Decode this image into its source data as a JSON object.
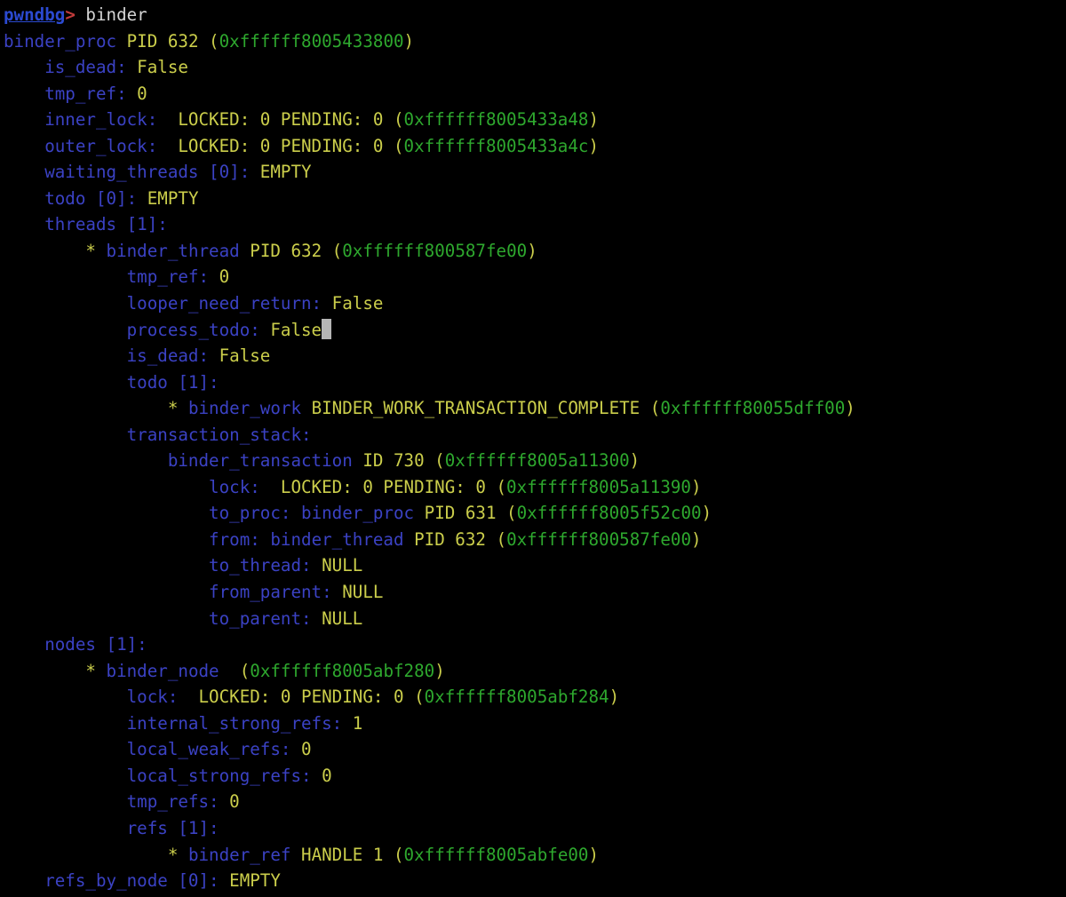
{
  "terminal": {
    "app": "pwndbg",
    "prompt": "pwndbg",
    "prompt_arrow": ">",
    "command": "binder",
    "cursor": "block",
    "colors": {
      "background": "#000000",
      "field": "#3b42c4",
      "value": "#cbce4b",
      "address": "#2ea82e",
      "command_text": "#d4d4d4",
      "prompt": "#2b4ad1",
      "prompt_arrow": "#c23b3b",
      "cursor": "#b5b5b5"
    },
    "lines": [
      {
        "id": "prompt-line",
        "segments": [
          {
            "t": "pwndbg",
            "c": "prompt"
          },
          {
            "t": ">",
            "c": "arrow"
          },
          {
            "t": " binder",
            "c": "white"
          }
        ]
      },
      {
        "id": "binder-proc-header",
        "segments": [
          {
            "t": "binder_proc",
            "c": "blue"
          },
          {
            "t": " PID 632 (",
            "c": "yellow"
          },
          {
            "t": "0xffffff8005433800",
            "c": "green"
          },
          {
            "t": ")",
            "c": "yellow"
          }
        ]
      },
      {
        "id": "proc-is-dead",
        "segments": [
          {
            "t": "    is_dead:",
            "c": "blue"
          },
          {
            "t": " False",
            "c": "yellow"
          }
        ]
      },
      {
        "id": "proc-tmp-ref",
        "segments": [
          {
            "t": "    tmp_ref:",
            "c": "blue"
          },
          {
            "t": " 0",
            "c": "yellow"
          }
        ]
      },
      {
        "id": "proc-inner-lock",
        "segments": [
          {
            "t": "    inner_lock:",
            "c": "blue"
          },
          {
            "t": "  LOCKED: 0 PENDING: 0 (",
            "c": "yellow"
          },
          {
            "t": "0xffffff8005433a48",
            "c": "green"
          },
          {
            "t": ")",
            "c": "yellow"
          }
        ]
      },
      {
        "id": "proc-outer-lock",
        "segments": [
          {
            "t": "    outer_lock:",
            "c": "blue"
          },
          {
            "t": "  LOCKED: 0 PENDING: 0 (",
            "c": "yellow"
          },
          {
            "t": "0xffffff8005433a4c",
            "c": "green"
          },
          {
            "t": ")",
            "c": "yellow"
          }
        ]
      },
      {
        "id": "proc-waiting-threads",
        "segments": [
          {
            "t": "    waiting_threads [0]:",
            "c": "blue"
          },
          {
            "t": " EMPTY",
            "c": "yellow"
          }
        ]
      },
      {
        "id": "proc-todo",
        "segments": [
          {
            "t": "    todo [0]:",
            "c": "blue"
          },
          {
            "t": " EMPTY",
            "c": "yellow"
          }
        ]
      },
      {
        "id": "proc-threads",
        "segments": [
          {
            "t": "    threads [1]:",
            "c": "blue"
          }
        ]
      },
      {
        "id": "thread-header",
        "segments": [
          {
            "t": "        * ",
            "c": "yellow"
          },
          {
            "t": "binder_thread",
            "c": "blue"
          },
          {
            "t": " PID 632 (",
            "c": "yellow"
          },
          {
            "t": "0xffffff800587fe00",
            "c": "green"
          },
          {
            "t": ")",
            "c": "yellow"
          }
        ]
      },
      {
        "id": "thread-tmp-ref",
        "segments": [
          {
            "t": "            tmp_ref:",
            "c": "blue"
          },
          {
            "t": " 0",
            "c": "yellow"
          }
        ]
      },
      {
        "id": "thread-looper-need-return",
        "segments": [
          {
            "t": "            looper_need_return:",
            "c": "blue"
          },
          {
            "t": " False",
            "c": "yellow"
          }
        ]
      },
      {
        "id": "thread-process-todo",
        "cursor_after": true,
        "segments": [
          {
            "t": "            process_todo:",
            "c": "blue"
          },
          {
            "t": " False",
            "c": "yellow"
          }
        ]
      },
      {
        "id": "thread-is-dead",
        "segments": [
          {
            "t": "            is_dead:",
            "c": "blue"
          },
          {
            "t": " False",
            "c": "yellow"
          }
        ]
      },
      {
        "id": "thread-todo",
        "segments": [
          {
            "t": "            todo [1]:",
            "c": "blue"
          }
        ]
      },
      {
        "id": "thread-todo-work",
        "segments": [
          {
            "t": "                * ",
            "c": "yellow"
          },
          {
            "t": "binder_work",
            "c": "blue"
          },
          {
            "t": " BINDER_WORK_TRANSACTION_COMPLETE (",
            "c": "yellow"
          },
          {
            "t": "0xffffff80055dff00",
            "c": "green"
          },
          {
            "t": ")",
            "c": "yellow"
          }
        ]
      },
      {
        "id": "thread-transaction-stack",
        "segments": [
          {
            "t": "            transaction_stack:",
            "c": "blue"
          }
        ]
      },
      {
        "id": "binder-transaction-header",
        "segments": [
          {
            "t": "                binder_transaction",
            "c": "blue"
          },
          {
            "t": " ID 730 (",
            "c": "yellow"
          },
          {
            "t": "0xffffff8005a11300",
            "c": "green"
          },
          {
            "t": ")",
            "c": "yellow"
          }
        ]
      },
      {
        "id": "transaction-lock",
        "segments": [
          {
            "t": "                    lock:",
            "c": "blue"
          },
          {
            "t": "  LOCKED: 0 PENDING: 0 (",
            "c": "yellow"
          },
          {
            "t": "0xffffff8005a11390",
            "c": "green"
          },
          {
            "t": ")",
            "c": "yellow"
          }
        ]
      },
      {
        "id": "transaction-to-proc",
        "segments": [
          {
            "t": "                    to_proc:",
            "c": "blue"
          },
          {
            "t": " ",
            "c": "yellow"
          },
          {
            "t": "binder_proc",
            "c": "blue"
          },
          {
            "t": " PID 631 (",
            "c": "yellow"
          },
          {
            "t": "0xffffff8005f52c00",
            "c": "green"
          },
          {
            "t": ")",
            "c": "yellow"
          }
        ]
      },
      {
        "id": "transaction-from",
        "segments": [
          {
            "t": "                    from:",
            "c": "blue"
          },
          {
            "t": " ",
            "c": "yellow"
          },
          {
            "t": "binder_thread",
            "c": "blue"
          },
          {
            "t": " PID 632 (",
            "c": "yellow"
          },
          {
            "t": "0xffffff800587fe00",
            "c": "green"
          },
          {
            "t": ")",
            "c": "yellow"
          }
        ]
      },
      {
        "id": "transaction-to-thread",
        "segments": [
          {
            "t": "                    to_thread:",
            "c": "blue"
          },
          {
            "t": " NULL",
            "c": "yellow"
          }
        ]
      },
      {
        "id": "transaction-from-parent",
        "segments": [
          {
            "t": "                    from_parent:",
            "c": "blue"
          },
          {
            "t": " NULL",
            "c": "yellow"
          }
        ]
      },
      {
        "id": "transaction-to-parent",
        "segments": [
          {
            "t": "                    to_parent:",
            "c": "blue"
          },
          {
            "t": " NULL",
            "c": "yellow"
          }
        ]
      },
      {
        "id": "proc-nodes",
        "segments": [
          {
            "t": "    nodes [1]:",
            "c": "blue"
          }
        ]
      },
      {
        "id": "binder-node-header",
        "segments": [
          {
            "t": "        * ",
            "c": "yellow"
          },
          {
            "t": "binder_node",
            "c": "blue"
          },
          {
            "t": "  (",
            "c": "yellow"
          },
          {
            "t": "0xffffff8005abf280",
            "c": "green"
          },
          {
            "t": ")",
            "c": "yellow"
          }
        ]
      },
      {
        "id": "node-lock",
        "segments": [
          {
            "t": "            lock:",
            "c": "blue"
          },
          {
            "t": "  LOCKED: 0 PENDING: 0 (",
            "c": "yellow"
          },
          {
            "t": "0xffffff8005abf284",
            "c": "green"
          },
          {
            "t": ")",
            "c": "yellow"
          }
        ]
      },
      {
        "id": "node-internal-strong-refs",
        "segments": [
          {
            "t": "            internal_strong_refs:",
            "c": "blue"
          },
          {
            "t": " 1",
            "c": "yellow"
          }
        ]
      },
      {
        "id": "node-local-weak-refs",
        "segments": [
          {
            "t": "            local_weak_refs:",
            "c": "blue"
          },
          {
            "t": " 0",
            "c": "yellow"
          }
        ]
      },
      {
        "id": "node-local-strong-refs",
        "segments": [
          {
            "t": "            local_strong_refs:",
            "c": "blue"
          },
          {
            "t": " 0",
            "c": "yellow"
          }
        ]
      },
      {
        "id": "node-tmp-refs",
        "segments": [
          {
            "t": "            tmp_refs:",
            "c": "blue"
          },
          {
            "t": " 0",
            "c": "yellow"
          }
        ]
      },
      {
        "id": "node-refs",
        "segments": [
          {
            "t": "            refs [1]:",
            "c": "blue"
          }
        ]
      },
      {
        "id": "binder-ref-entry",
        "segments": [
          {
            "t": "                * ",
            "c": "yellow"
          },
          {
            "t": "binder_ref",
            "c": "blue"
          },
          {
            "t": " HANDLE 1 (",
            "c": "yellow"
          },
          {
            "t": "0xffffff8005abfe00",
            "c": "green"
          },
          {
            "t": ")",
            "c": "yellow"
          }
        ]
      },
      {
        "id": "proc-refs-by-node",
        "segments": [
          {
            "t": "    refs_by_node [0]:",
            "c": "blue"
          },
          {
            "t": " EMPTY",
            "c": "yellow"
          }
        ]
      }
    ]
  }
}
